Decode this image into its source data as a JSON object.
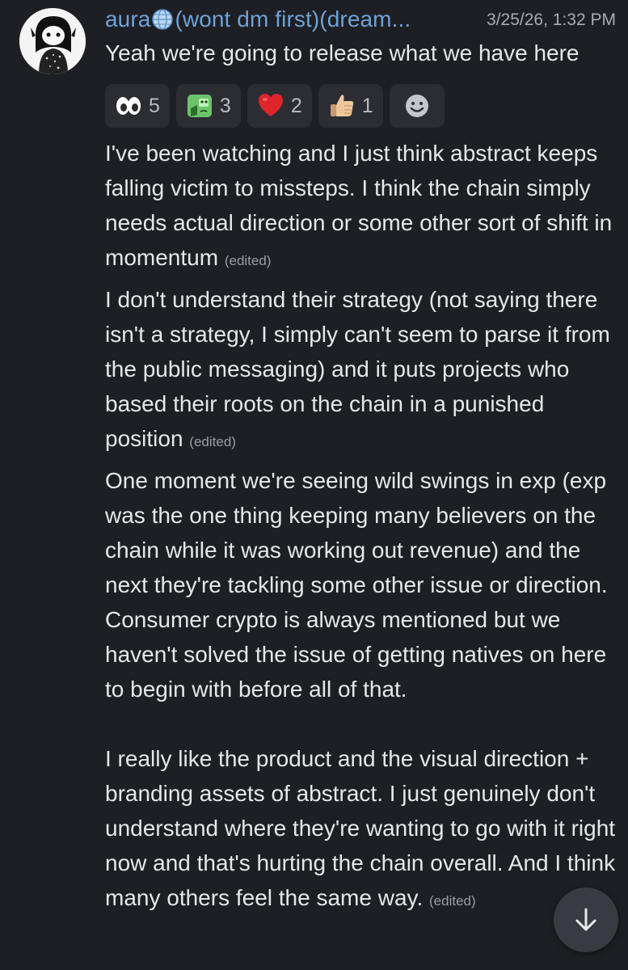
{
  "author": {
    "name_prefix": "aura",
    "name_suffix": "(wont dm first)(dream...",
    "timestamp": "3/25/26, 1:32 PM"
  },
  "first_message": "Yeah we're going to release what we have here",
  "reactions": [
    {
      "icon": "eyes-emoji",
      "count": "5"
    },
    {
      "icon": "thinking-face-emoji",
      "count": "3"
    },
    {
      "icon": "red-heart-emoji",
      "count": "2"
    },
    {
      "icon": "thumbs-up-emoji",
      "count": "1"
    }
  ],
  "add_reaction_icon": "smiley-add-reaction-icon",
  "messages": [
    {
      "text": "I've been watching and I just think abstract keeps falling victim to missteps. I think the chain simply needs actual direction or some other sort of shift in momentum ",
      "edited": "(edited)"
    },
    {
      "text": "I don't understand their strategy (not saying there isn't a strategy, I simply can't seem to parse it from the public messaging) and it puts projects who based their roots on the chain in a punished position ",
      "edited": "(edited)"
    },
    {
      "text": "One moment we're seeing wild swings in exp (exp was the one thing keeping many believers on the chain while it was working out revenue) and the next they're tackling some other issue or direction. Consumer crypto is always mentioned but we haven't solved the issue of getting natives on here to begin with before all of that.\n\nI really like the product and the visual direction + branding assets of abstract. I just genuinely don't understand where they're wanting to go with it right now and that's hurting the chain overall. And I think many others feel the same way. ",
      "edited": "(edited)"
    }
  ],
  "colors": {
    "background": "#1e1f24",
    "username": "#6ea2d8",
    "text": "#e6e7ea",
    "muted": "#9a9da4",
    "reaction_bg": "#2c2d33"
  },
  "scroll_button_icon": "arrow-down-icon"
}
